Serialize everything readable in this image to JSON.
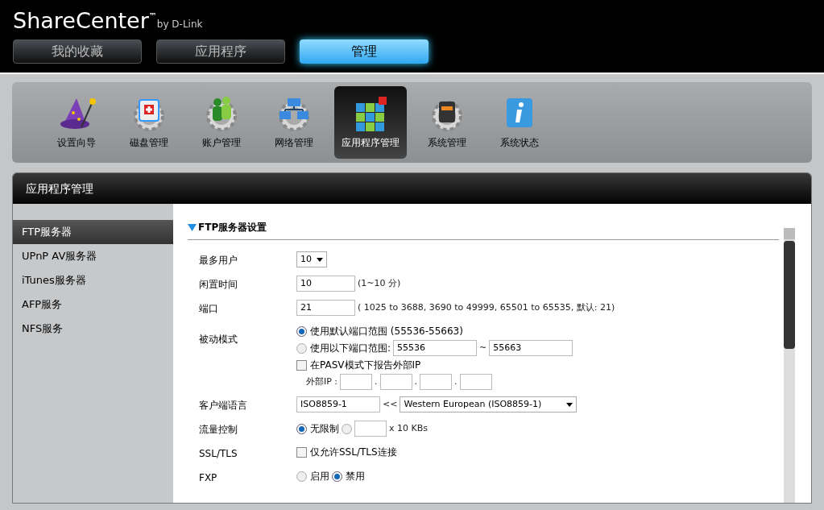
{
  "brand": {
    "name": "ShareCenter",
    "trademark": "™",
    "by": "by D-Link"
  },
  "top_tabs": [
    {
      "label": "我的收藏",
      "selected": false
    },
    {
      "label": "应用程序",
      "selected": false
    },
    {
      "label": "管理",
      "selected": true
    }
  ],
  "toolbar": [
    {
      "label": "设置向导",
      "selected": false
    },
    {
      "label": "磁盘管理",
      "selected": false
    },
    {
      "label": "账户管理",
      "selected": false
    },
    {
      "label": "网络管理",
      "selected": false
    },
    {
      "label": "应用程序管理",
      "selected": true
    },
    {
      "label": "系统管理",
      "selected": false
    },
    {
      "label": "系统状态",
      "selected": false
    }
  ],
  "panel": {
    "title": "应用程序管理"
  },
  "sidebar": {
    "items": [
      {
        "label": "FTP服务器",
        "selected": true
      },
      {
        "label": "UPnP AV服务器",
        "selected": false
      },
      {
        "label": "iTunes服务器",
        "selected": false
      },
      {
        "label": "AFP服务",
        "selected": false
      },
      {
        "label": "NFS服务",
        "selected": false
      }
    ]
  },
  "section": {
    "title": "FTP服务器设置",
    "expanded": true
  },
  "form": [
    {
      "label": "最多用户",
      "lines": [
        [
          {
            "kind": "select",
            "value": "10"
          }
        ]
      ]
    },
    {
      "label": "闲置时间",
      "lines": [
        [
          {
            "kind": "input",
            "value": "10"
          },
          {
            "kind": "text",
            "text": "(1~10 分)"
          }
        ]
      ]
    },
    {
      "label": "端口",
      "lines": [
        [
          {
            "kind": "input",
            "value": "21"
          },
          {
            "kind": "text",
            "text": "( 1025 to 3688, 3690 to 49999, 65501 to 65535, 默认: 21)"
          }
        ]
      ]
    },
    {
      "label": "被动模式",
      "lines": [
        [
          {
            "kind": "radio",
            "label": "使用默认端口范围 (55536-55663)",
            "selected": true
          }
        ],
        [
          {
            "kind": "radio",
            "label": "使用以下端口范围:",
            "selected": false
          },
          {
            "kind": "wide_input",
            "value": "55536"
          },
          {
            "kind": "text",
            "text": "~"
          },
          {
            "kind": "wide_input",
            "value": "55663"
          }
        ],
        [
          {
            "kind": "checkbox",
            "label": "在PASV模式下报告外部IP",
            "checked": false
          }
        ],
        [
          {
            "kind": "text",
            "text": "外部IP :"
          },
          {
            "kind": "small_input"
          },
          {
            "kind": "text",
            "text": "."
          },
          {
            "kind": "small_input"
          },
          {
            "kind": "text",
            "text": "."
          },
          {
            "kind": "small_input"
          },
          {
            "kind": "text",
            "text": "."
          },
          {
            "kind": "small_input"
          }
        ]
      ]
    },
    {
      "label": "客户端语言",
      "lines": [
        [
          {
            "kind": "wide_input",
            "value": "ISO8859-1"
          },
          {
            "kind": "text",
            "text": "<<"
          },
          {
            "kind": "wide_select",
            "value": "Western European (ISO8859-1)"
          }
        ]
      ]
    },
    {
      "label": "流量控制",
      "lines": [
        [
          {
            "kind": "radio",
            "label": "无限制",
            "selected": true
          },
          {
            "kind": "radio",
            "selected": false
          },
          {
            "kind": "small_input"
          },
          {
            "kind": "text",
            "text": "x 10 KBs"
          }
        ]
      ]
    },
    {
      "label": "SSL/TLS",
      "lines": [
        [
          {
            "kind": "checkbox",
            "label": "仅允许SSL/TLS连接",
            "checked": false
          }
        ]
      ]
    },
    {
      "label": "FXP",
      "lines": [
        [
          {
            "kind": "radio",
            "label": "启用",
            "selected": false
          },
          {
            "kind": "radio",
            "label": "禁用",
            "selected": true
          }
        ]
      ]
    }
  ]
}
